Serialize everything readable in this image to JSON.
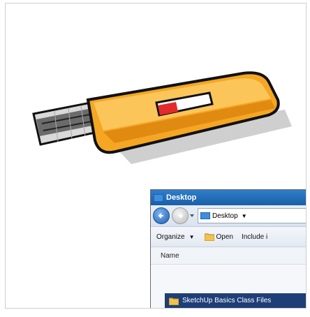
{
  "explorer": {
    "title": "Desktop",
    "address": "Desktop",
    "commands": {
      "organize": "Organize",
      "open": "Open",
      "include": "Include i"
    },
    "column_header": "Name",
    "selected_item": "SketchUp Basics Class Files"
  },
  "icons": [
    "usb-drive-illustration",
    "window-icon",
    "back-arrow-icon",
    "forward-arrow-icon",
    "dropdown-arrow-icon",
    "desktop-icon",
    "folder-icon"
  ],
  "colors": {
    "usb_body": "#f5a623",
    "usb_slider": "#e32b2b",
    "title_bar": "#1a5ea8",
    "selection": "#1e3e78"
  }
}
